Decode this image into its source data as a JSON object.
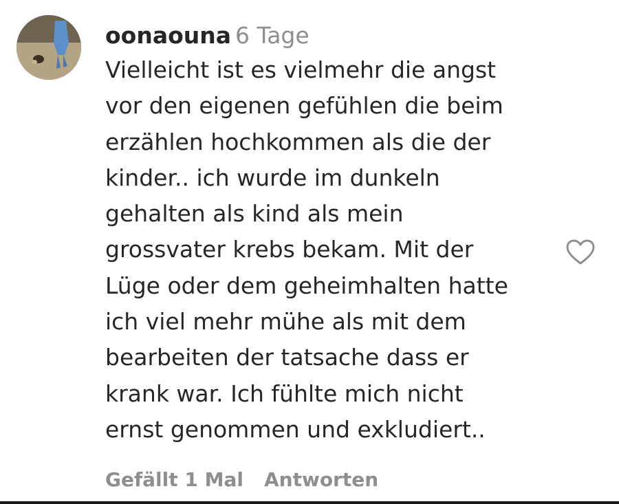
{
  "comment": {
    "username": "oonaouna",
    "time": "6 Tage",
    "text_lines": [
      "Vielleicht ist es vielmehr die angst",
      "vor den eigenen gefühlen die beim",
      "erzählen hochkommen als die der",
      "kinder.. ich wurde im dunkeln",
      "gehalten als kind als mein",
      "grossvater krebs bekam. Mit der",
      "Lüge oder dem geheimhalten hatte",
      "ich viel mehr mühe als mit dem",
      "bearbeiten der tatsache dass er",
      "krank war. Ich fühlte mich nicht",
      "ernst genommen und exkludiert.."
    ],
    "likes_label": "Gefällt 1 Mal",
    "reply_label": "Antworten",
    "like_icon": "heart-outline-icon"
  }
}
